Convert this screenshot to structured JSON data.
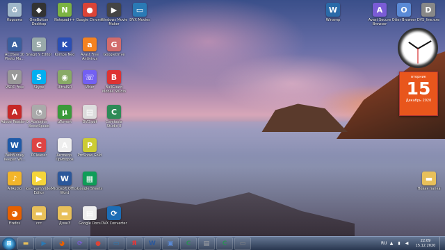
{
  "desktop_icons": [
    {
      "label": "Корзина",
      "icon": "recycle-bin-icon",
      "color": "#9fb7c9",
      "glyph": "♻"
    },
    {
      "label": "OneButton Desktop",
      "icon": "app-icon",
      "color": "#333",
      "glyph": "◆"
    },
    {
      "label": "Notepad++",
      "icon": "notepad-icon",
      "color": "#7cb342",
      "glyph": "N"
    },
    {
      "label": "Google Chrome",
      "icon": "chrome-icon",
      "color": "#db4437",
      "glyph": "●"
    },
    {
      "label": "Windows Movie Maker",
      "icon": "film-icon",
      "color": "#444",
      "glyph": "▶"
    },
    {
      "label": "DVX Movies",
      "icon": "monitor-icon",
      "color": "#2a7ab5",
      "glyph": "▭"
    },
    {
      "label": "ACDSee 10 Photo Ma...",
      "icon": "acdsee-icon",
      "color": "#3a5f9e",
      "glyph": "A"
    },
    {
      "label": "Snagit 9 Editor",
      "icon": "snagit-icon",
      "color": "#9aa",
      "glyph": "S"
    },
    {
      "label": "Kompa Neo",
      "icon": "app-icon",
      "color": "#2a4fb5",
      "glyph": "K"
    },
    {
      "label": "Avast Free Antivirus",
      "icon": "avast-icon",
      "color": "#f58220",
      "glyph": "a"
    },
    {
      "label": "GoogleDrive",
      "icon": "app-icon",
      "color": "#d26b6b",
      "glyph": "G"
    },
    {
      "label": "VSDC Free",
      "icon": "app-icon",
      "color": "#999",
      "glyph": "V"
    },
    {
      "label": "Skype",
      "icon": "skype-icon",
      "color": "#00aff0",
      "glyph": "S"
    },
    {
      "label": "UltraISO",
      "icon": "disc-icon",
      "color": "#8a6",
      "glyph": "◉"
    },
    {
      "label": "Viber",
      "icon": "viber-icon",
      "color": "#7360f2",
      "glyph": "☏"
    },
    {
      "label": "BullGuard Mobile Studio",
      "icon": "app-icon",
      "color": "#d33",
      "glyph": "B"
    },
    {
      "label": "Adobe Reader 9",
      "icon": "pdf-icon",
      "color": "#c62828",
      "glyph": "A"
    },
    {
      "label": "Auslogics BoostSpeed",
      "icon": "app-icon",
      "color": "#aaa",
      "glyph": "◔"
    },
    {
      "label": "µTorrent",
      "icon": "utorrent-icon",
      "color": "#3a9a3a",
      "glyph": "µ"
    },
    {
      "label": "DVD.pdf",
      "icon": "document-icon",
      "color": "#ddd",
      "glyph": "▤"
    },
    {
      "label": "Camtasia Studio 8",
      "icon": "camtasia-icon",
      "color": "#2e8b57",
      "glyph": "C"
    },
    {
      "label": "WebMoney Keeper Wi...",
      "icon": "webmoney-icon",
      "color": "#1e5aa8",
      "glyph": "W"
    },
    {
      "label": "CCleaner",
      "icon": "ccleaner-icon",
      "color": "#d44",
      "glyph": "C"
    },
    {
      "label": "Автокор. Приборов",
      "icon": "font-icon",
      "color": "#eee",
      "glyph": "A"
    },
    {
      "label": "ProShow Gold",
      "icon": "app-icon",
      "color": "#cc3",
      "glyph": "P"
    },
    {
      "label": "AllAudio",
      "icon": "audio-icon",
      "color": "#f2b52a",
      "glyph": "♪"
    },
    {
      "label": "Icecream Video Editor",
      "icon": "video-icon",
      "color": "#f5d53a",
      "glyph": "▶"
    },
    {
      "label": "Microsoft Office Word",
      "icon": "word-icon",
      "color": "#2b579a",
      "glyph": "W"
    },
    {
      "label": "Google Sheets",
      "icon": "sheets-icon",
      "color": "#0f9d58",
      "glyph": "▦"
    },
    {
      "label": "Firefox",
      "icon": "firefox-icon",
      "color": "#e66000",
      "glyph": "◕"
    },
    {
      "label": "ссс",
      "icon": "folder-icon",
      "color": "#e8c05a",
      "glyph": "▬"
    },
    {
      "label": "ДлякЗ",
      "icon": "folder-icon",
      "color": "#e8c05a",
      "glyph": "▬"
    },
    {
      "label": "Google Docs",
      "icon": "docs-icon",
      "color": "#eee",
      "glyph": "▤"
    },
    {
      "label": "DVX Converter",
      "icon": "converter-icon",
      "color": "#1c6db5",
      "glyph": "⟳"
    },
    {
      "label": "Winamp",
      "icon": "winamp-icon",
      "color": "#2a6aa8",
      "glyph": "W"
    },
    {
      "label": "Avast Secure Browser",
      "icon": "browser-icon",
      "color": "#7a5cd6",
      "glyph": "A"
    },
    {
      "label": "Otter Browser",
      "icon": "browser-icon",
      "color": "#5a8ad6",
      "glyph": "O"
    },
    {
      "label": "DVS_line.exe",
      "icon": "app-icon",
      "color": "#888",
      "glyph": "D"
    },
    {
      "label": "Новая папка",
      "icon": "folder-icon",
      "color": "#e8c05a",
      "glyph": "▬"
    }
  ],
  "calendar": {
    "weekday": "вторник",
    "day": "15",
    "month_year": "Декабрь 2020"
  },
  "clock": {
    "hour": 10,
    "minute": 10,
    "second": 30
  },
  "taskbar": {
    "items": [
      {
        "name": "explorer",
        "color": "#e8c05a",
        "glyph": "▬"
      },
      {
        "name": "media",
        "color": "#2a7ab5",
        "glyph": "▶"
      },
      {
        "name": "firefox",
        "color": "#e66000",
        "glyph": "◕"
      },
      {
        "name": "browser",
        "color": "#7a5cd6",
        "glyph": "⟳"
      },
      {
        "name": "chrome",
        "color": "#db4437",
        "glyph": "●"
      },
      {
        "name": "monitor",
        "color": "#2a7ab5",
        "glyph": "▭"
      },
      {
        "name": "yandex",
        "color": "#e33",
        "glyph": "Я"
      },
      {
        "name": "word",
        "color": "#2b579a",
        "glyph": "W"
      },
      {
        "name": "app",
        "color": "#5a8ad6",
        "glyph": "▣"
      },
      {
        "name": "camtasia",
        "color": "#2e8b57",
        "glyph": "C"
      },
      {
        "name": "notes",
        "color": "#aaa",
        "glyph": "▤"
      },
      {
        "name": "camtasia2",
        "color": "#2e8b57",
        "glyph": "C"
      },
      {
        "name": "screen",
        "color": "#888",
        "glyph": "▭"
      }
    ],
    "time": "22:09",
    "date": "15.12.2020",
    "lang": "RU"
  }
}
